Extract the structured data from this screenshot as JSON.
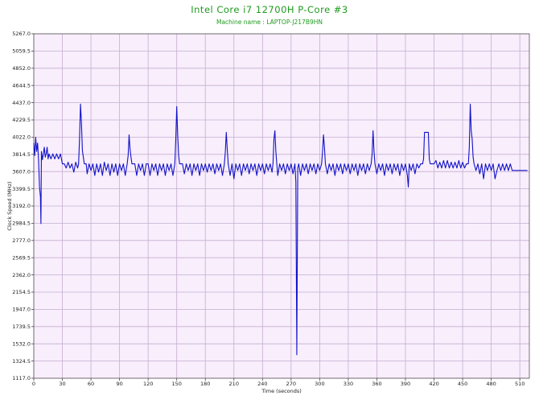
{
  "chart_data": {
    "type": "line",
    "title": "Intel Core i7 12700H P-Core #3",
    "subtitle": "Machine name : LAPTOP-J217B9HN",
    "xlabel": "Time (seconds)",
    "ylabel": "Clock Speed (MHz)",
    "xlim": [
      0,
      520
    ],
    "ylim": [
      1117.0,
      5267.0
    ],
    "x_ticks": [
      0,
      30,
      60,
      90,
      120,
      150,
      180,
      210,
      240,
      270,
      300,
      330,
      360,
      390,
      420,
      450,
      480,
      510
    ],
    "y_ticks": [
      "1117.0",
      "1324.5",
      "1532.0",
      "1739.5",
      "1947.0",
      "2154.5",
      "2362.0",
      "2569.5",
      "2777.0",
      "2984.5",
      "3192.0",
      "3399.5",
      "3607.0",
      "3814.5",
      "4022.0",
      "4229.5",
      "4437.0",
      "4644.5",
      "4852.0",
      "5059.5",
      "5267.0"
    ],
    "grid": true,
    "plot_background": "#f8eefc",
    "grid_color": "#c6aed0",
    "line_color": "#1212c8",
    "series": [
      {
        "points": [
          [
            0,
            3950
          ],
          [
            1,
            3800
          ],
          [
            2,
            4020
          ],
          [
            3,
            3850
          ],
          [
            4,
            3950
          ],
          [
            5,
            3750
          ],
          [
            6,
            3420
          ],
          [
            7,
            3300
          ],
          [
            7.5,
            2980
          ],
          [
            8,
            3850
          ],
          [
            9,
            3750
          ],
          [
            10,
            3820
          ],
          [
            11,
            3900
          ],
          [
            12,
            3780
          ],
          [
            13,
            3820
          ],
          [
            14,
            3900
          ],
          [
            15,
            3760
          ],
          [
            16,
            3820
          ],
          [
            18,
            3760
          ],
          [
            20,
            3820
          ],
          [
            22,
            3760
          ],
          [
            24,
            3820
          ],
          [
            26,
            3760
          ],
          [
            28,
            3820
          ],
          [
            30,
            3700
          ],
          [
            32,
            3700
          ],
          [
            34,
            3650
          ],
          [
            36,
            3720
          ],
          [
            38,
            3650
          ],
          [
            40,
            3700
          ],
          [
            42,
            3600
          ],
          [
            44,
            3720
          ],
          [
            46,
            3650
          ],
          [
            47,
            3700
          ],
          [
            48,
            4000
          ],
          [
            49,
            4420
          ],
          [
            50,
            4200
          ],
          [
            51,
            3860
          ],
          [
            52,
            3780
          ],
          [
            53,
            3700
          ],
          [
            55,
            3700
          ],
          [
            56,
            3580
          ],
          [
            58,
            3700
          ],
          [
            60,
            3620
          ],
          [
            62,
            3700
          ],
          [
            64,
            3560
          ],
          [
            66,
            3700
          ],
          [
            68,
            3600
          ],
          [
            70,
            3700
          ],
          [
            72,
            3560
          ],
          [
            74,
            3720
          ],
          [
            76,
            3620
          ],
          [
            78,
            3700
          ],
          [
            80,
            3560
          ],
          [
            82,
            3700
          ],
          [
            84,
            3600
          ],
          [
            86,
            3700
          ],
          [
            88,
            3560
          ],
          [
            90,
            3700
          ],
          [
            92,
            3620
          ],
          [
            94,
            3700
          ],
          [
            96,
            3560
          ],
          [
            98,
            3700
          ],
          [
            99,
            3800
          ],
          [
            100,
            4050
          ],
          [
            101,
            3880
          ],
          [
            102,
            3780
          ],
          [
            103,
            3700
          ],
          [
            106,
            3700
          ],
          [
            108,
            3560
          ],
          [
            110,
            3700
          ],
          [
            112,
            3620
          ],
          [
            114,
            3700
          ],
          [
            116,
            3560
          ],
          [
            118,
            3700
          ],
          [
            120,
            3700
          ],
          [
            122,
            3560
          ],
          [
            124,
            3700
          ],
          [
            126,
            3620
          ],
          [
            128,
            3700
          ],
          [
            130,
            3560
          ],
          [
            132,
            3700
          ],
          [
            134,
            3620
          ],
          [
            136,
            3700
          ],
          [
            138,
            3560
          ],
          [
            140,
            3700
          ],
          [
            142,
            3620
          ],
          [
            144,
            3700
          ],
          [
            146,
            3560
          ],
          [
            148,
            3700
          ],
          [
            149,
            4000
          ],
          [
            150,
            4390
          ],
          [
            151,
            4050
          ],
          [
            152,
            3800
          ],
          [
            153,
            3700
          ],
          [
            156,
            3700
          ],
          [
            158,
            3580
          ],
          [
            160,
            3700
          ],
          [
            162,
            3620
          ],
          [
            164,
            3700
          ],
          [
            166,
            3560
          ],
          [
            168,
            3700
          ],
          [
            170,
            3620
          ],
          [
            172,
            3700
          ],
          [
            174,
            3560
          ],
          [
            176,
            3700
          ],
          [
            178,
            3620
          ],
          [
            180,
            3700
          ],
          [
            182,
            3600
          ],
          [
            184,
            3700
          ],
          [
            186,
            3620
          ],
          [
            188,
            3700
          ],
          [
            190,
            3580
          ],
          [
            192,
            3700
          ],
          [
            194,
            3620
          ],
          [
            196,
            3700
          ],
          [
            198,
            3560
          ],
          [
            200,
            3700
          ],
          [
            201,
            3850
          ],
          [
            202,
            4080
          ],
          [
            203,
            3880
          ],
          [
            204,
            3700
          ],
          [
            206,
            3560
          ],
          [
            208,
            3700
          ],
          [
            210,
            3520
          ],
          [
            212,
            3700
          ],
          [
            214,
            3620
          ],
          [
            216,
            3700
          ],
          [
            218,
            3560
          ],
          [
            220,
            3700
          ],
          [
            222,
            3620
          ],
          [
            224,
            3700
          ],
          [
            226,
            3580
          ],
          [
            228,
            3700
          ],
          [
            230,
            3620
          ],
          [
            232,
            3700
          ],
          [
            234,
            3560
          ],
          [
            236,
            3700
          ],
          [
            238,
            3620
          ],
          [
            240,
            3700
          ],
          [
            242,
            3580
          ],
          [
            244,
            3700
          ],
          [
            246,
            3620
          ],
          [
            248,
            3700
          ],
          [
            250,
            3600
          ],
          [
            251,
            3700
          ],
          [
            252,
            4000
          ],
          [
            253,
            4100
          ],
          [
            254,
            3850
          ],
          [
            255,
            3700
          ],
          [
            256,
            3560
          ],
          [
            258,
            3700
          ],
          [
            260,
            3620
          ],
          [
            262,
            3700
          ],
          [
            264,
            3580
          ],
          [
            266,
            3700
          ],
          [
            268,
            3620
          ],
          [
            270,
            3700
          ],
          [
            272,
            3580
          ],
          [
            274,
            3700
          ],
          [
            275,
            3480
          ],
          [
            276,
            1400
          ],
          [
            277,
            3650
          ],
          [
            278,
            3700
          ],
          [
            280,
            3560
          ],
          [
            282,
            3700
          ],
          [
            284,
            3620
          ],
          [
            286,
            3700
          ],
          [
            288,
            3580
          ],
          [
            290,
            3700
          ],
          [
            292,
            3620
          ],
          [
            294,
            3700
          ],
          [
            296,
            3580
          ],
          [
            298,
            3700
          ],
          [
            300,
            3620
          ],
          [
            302,
            3700
          ],
          [
            303,
            3850
          ],
          [
            304,
            4050
          ],
          [
            305,
            3900
          ],
          [
            306,
            3700
          ],
          [
            308,
            3580
          ],
          [
            310,
            3700
          ],
          [
            312,
            3620
          ],
          [
            314,
            3700
          ],
          [
            316,
            3560
          ],
          [
            318,
            3700
          ],
          [
            320,
            3620
          ],
          [
            322,
            3700
          ],
          [
            324,
            3580
          ],
          [
            326,
            3700
          ],
          [
            328,
            3620
          ],
          [
            330,
            3700
          ],
          [
            332,
            3580
          ],
          [
            334,
            3700
          ],
          [
            336,
            3620
          ],
          [
            338,
            3700
          ],
          [
            340,
            3560
          ],
          [
            342,
            3700
          ],
          [
            344,
            3620
          ],
          [
            346,
            3700
          ],
          [
            348,
            3580
          ],
          [
            350,
            3700
          ],
          [
            352,
            3620
          ],
          [
            354,
            3700
          ],
          [
            355,
            3820
          ],
          [
            356,
            4100
          ],
          [
            357,
            3850
          ],
          [
            358,
            3700
          ],
          [
            360,
            3580
          ],
          [
            362,
            3700
          ],
          [
            364,
            3620
          ],
          [
            366,
            3700
          ],
          [
            368,
            3560
          ],
          [
            370,
            3700
          ],
          [
            372,
            3620
          ],
          [
            374,
            3700
          ],
          [
            376,
            3580
          ],
          [
            378,
            3700
          ],
          [
            380,
            3620
          ],
          [
            382,
            3700
          ],
          [
            384,
            3560
          ],
          [
            386,
            3700
          ],
          [
            388,
            3620
          ],
          [
            390,
            3700
          ],
          [
            392,
            3560
          ],
          [
            393,
            3420
          ],
          [
            394,
            3700
          ],
          [
            396,
            3620
          ],
          [
            398,
            3700
          ],
          [
            400,
            3580
          ],
          [
            402,
            3700
          ],
          [
            404,
            3650
          ],
          [
            406,
            3700
          ],
          [
            408,
            3700
          ],
          [
            409,
            3760
          ],
          [
            410,
            4080
          ],
          [
            414,
            4080
          ],
          [
            415,
            3760
          ],
          [
            416,
            3700
          ],
          [
            418,
            3700
          ],
          [
            420,
            3700
          ],
          [
            422,
            3740
          ],
          [
            424,
            3650
          ],
          [
            426,
            3720
          ],
          [
            428,
            3650
          ],
          [
            430,
            3740
          ],
          [
            432,
            3650
          ],
          [
            434,
            3740
          ],
          [
            436,
            3650
          ],
          [
            438,
            3720
          ],
          [
            440,
            3650
          ],
          [
            442,
            3720
          ],
          [
            444,
            3650
          ],
          [
            446,
            3740
          ],
          [
            448,
            3650
          ],
          [
            450,
            3720
          ],
          [
            452,
            3650
          ],
          [
            454,
            3700
          ],
          [
            456,
            3700
          ],
          [
            457,
            3900
          ],
          [
            458,
            4420
          ],
          [
            459,
            4100
          ],
          [
            460,
            4000
          ],
          [
            461,
            3780
          ],
          [
            462,
            3700
          ],
          [
            464,
            3620
          ],
          [
            466,
            3700
          ],
          [
            468,
            3580
          ],
          [
            470,
            3700
          ],
          [
            472,
            3520
          ],
          [
            474,
            3700
          ],
          [
            476,
            3620
          ],
          [
            478,
            3700
          ],
          [
            480,
            3620
          ],
          [
            482,
            3700
          ],
          [
            484,
            3520
          ],
          [
            486,
            3620
          ],
          [
            488,
            3700
          ],
          [
            490,
            3620
          ],
          [
            492,
            3700
          ],
          [
            494,
            3620
          ],
          [
            496,
            3700
          ],
          [
            498,
            3620
          ],
          [
            500,
            3700
          ],
          [
            502,
            3620
          ],
          [
            504,
            3620
          ],
          [
            506,
            3620
          ],
          [
            508,
            3620
          ],
          [
            510,
            3620
          ],
          [
            512,
            3620
          ],
          [
            514,
            3620
          ],
          [
            516,
            3620
          ],
          [
            518,
            3620
          ]
        ]
      }
    ]
  }
}
